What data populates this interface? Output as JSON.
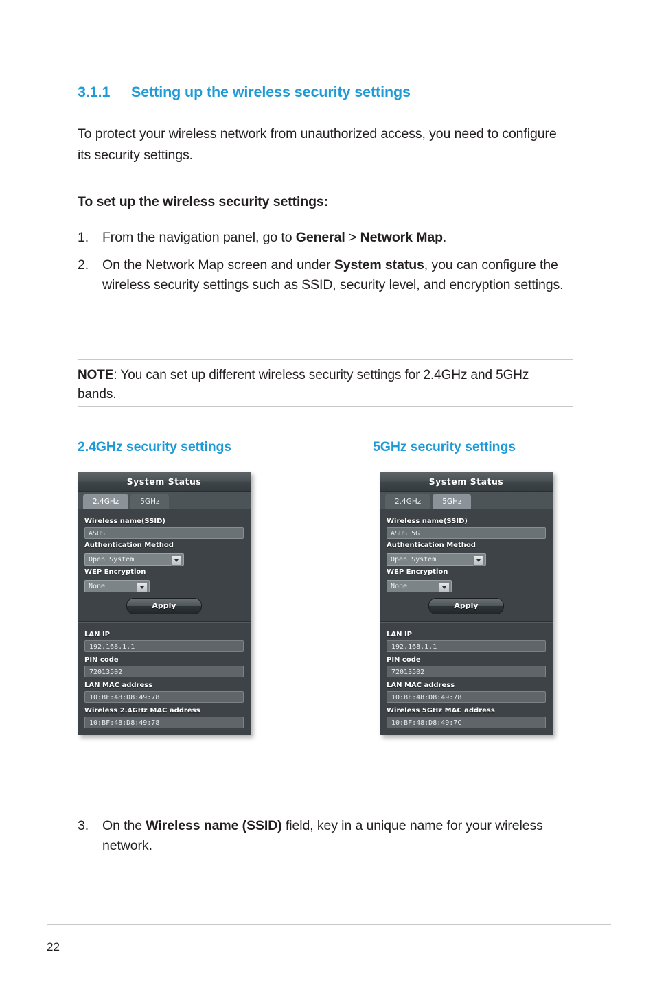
{
  "section": {
    "number": "3.1.1",
    "title": "Setting up the wireless security settings",
    "intro": "To protect your wireless network from unauthorized access, you need to configure its security settings.",
    "subheading": "To set up the wireless security settings:"
  },
  "steps": [
    {
      "marker": "1.",
      "text_parts": [
        {
          "text": "From the navigation panel, go to ",
          "bold": false
        },
        {
          "text": "General",
          "bold": true
        },
        {
          "text": " > ",
          "bold": false
        },
        {
          "text": "Network Map",
          "bold": true
        },
        {
          "text": ".",
          "bold": false
        }
      ]
    },
    {
      "marker": "2.",
      "text_parts": [
        {
          "text": "On the Network Map screen and under ",
          "bold": false
        },
        {
          "text": "System status",
          "bold": true
        },
        {
          "text": ", you can configure the wireless security settings such as SSID, security level, and encryption settings.",
          "bold": false
        }
      ]
    },
    {
      "marker": "3.",
      "text_parts": [
        {
          "text": "On the ",
          "bold": false
        },
        {
          "text": "Wireless name (SSID)",
          "bold": true
        },
        {
          "text": " field, key in a unique name for your wireless network.",
          "bold": false
        }
      ]
    }
  ],
  "note": {
    "label": "NOTE",
    "text": ": You can set up different wireless security settings for 2.4GHz and 5GHz bands."
  },
  "captions": {
    "left": "2.4GHz security settings",
    "right": "5GHz security settings"
  },
  "panel_24": {
    "title": "System Status",
    "tabs": [
      {
        "label": "2.4GHz",
        "active": true
      },
      {
        "label": "5GHz",
        "active": false
      }
    ],
    "ssid_label": "Wireless name(SSID)",
    "ssid_value": "ASUS",
    "auth_label": "Authentication Method",
    "auth_value": "Open System",
    "wep_label": "WEP Encryption",
    "wep_value": "None",
    "apply_label": "Apply",
    "info": [
      {
        "label": "LAN IP",
        "value": "192.168.1.1"
      },
      {
        "label": "PIN code",
        "value": "72013502"
      },
      {
        "label": "LAN MAC address",
        "value": "10:BF:48:D8:49:78"
      },
      {
        "label": "Wireless 2.4GHz MAC address",
        "value": "10:BF:48:D8:49:78"
      }
    ]
  },
  "panel_5": {
    "title": "System Status",
    "tabs": [
      {
        "label": "2.4GHz",
        "active": false
      },
      {
        "label": "5GHz",
        "active": true
      }
    ],
    "ssid_label": "Wireless name(SSID)",
    "ssid_value": "ASUS_5G",
    "auth_label": "Authentication Method",
    "auth_value": "Open System",
    "wep_label": "WEP Encryption",
    "wep_value": "None",
    "apply_label": "Apply",
    "info": [
      {
        "label": "LAN IP",
        "value": "192.168.1.1"
      },
      {
        "label": "PIN code",
        "value": "72013502"
      },
      {
        "label": "LAN MAC address",
        "value": "10:BF:48:D8:49:78"
      },
      {
        "label": "Wireless 5GHz MAC address",
        "value": "10:BF:48:D8:49:7C"
      }
    ]
  },
  "footer": {
    "page_number": "22"
  },
  "colors": {
    "heading": "#1e9ad6",
    "body_text": "#231f20",
    "panel_bg": "#3d4346"
  }
}
